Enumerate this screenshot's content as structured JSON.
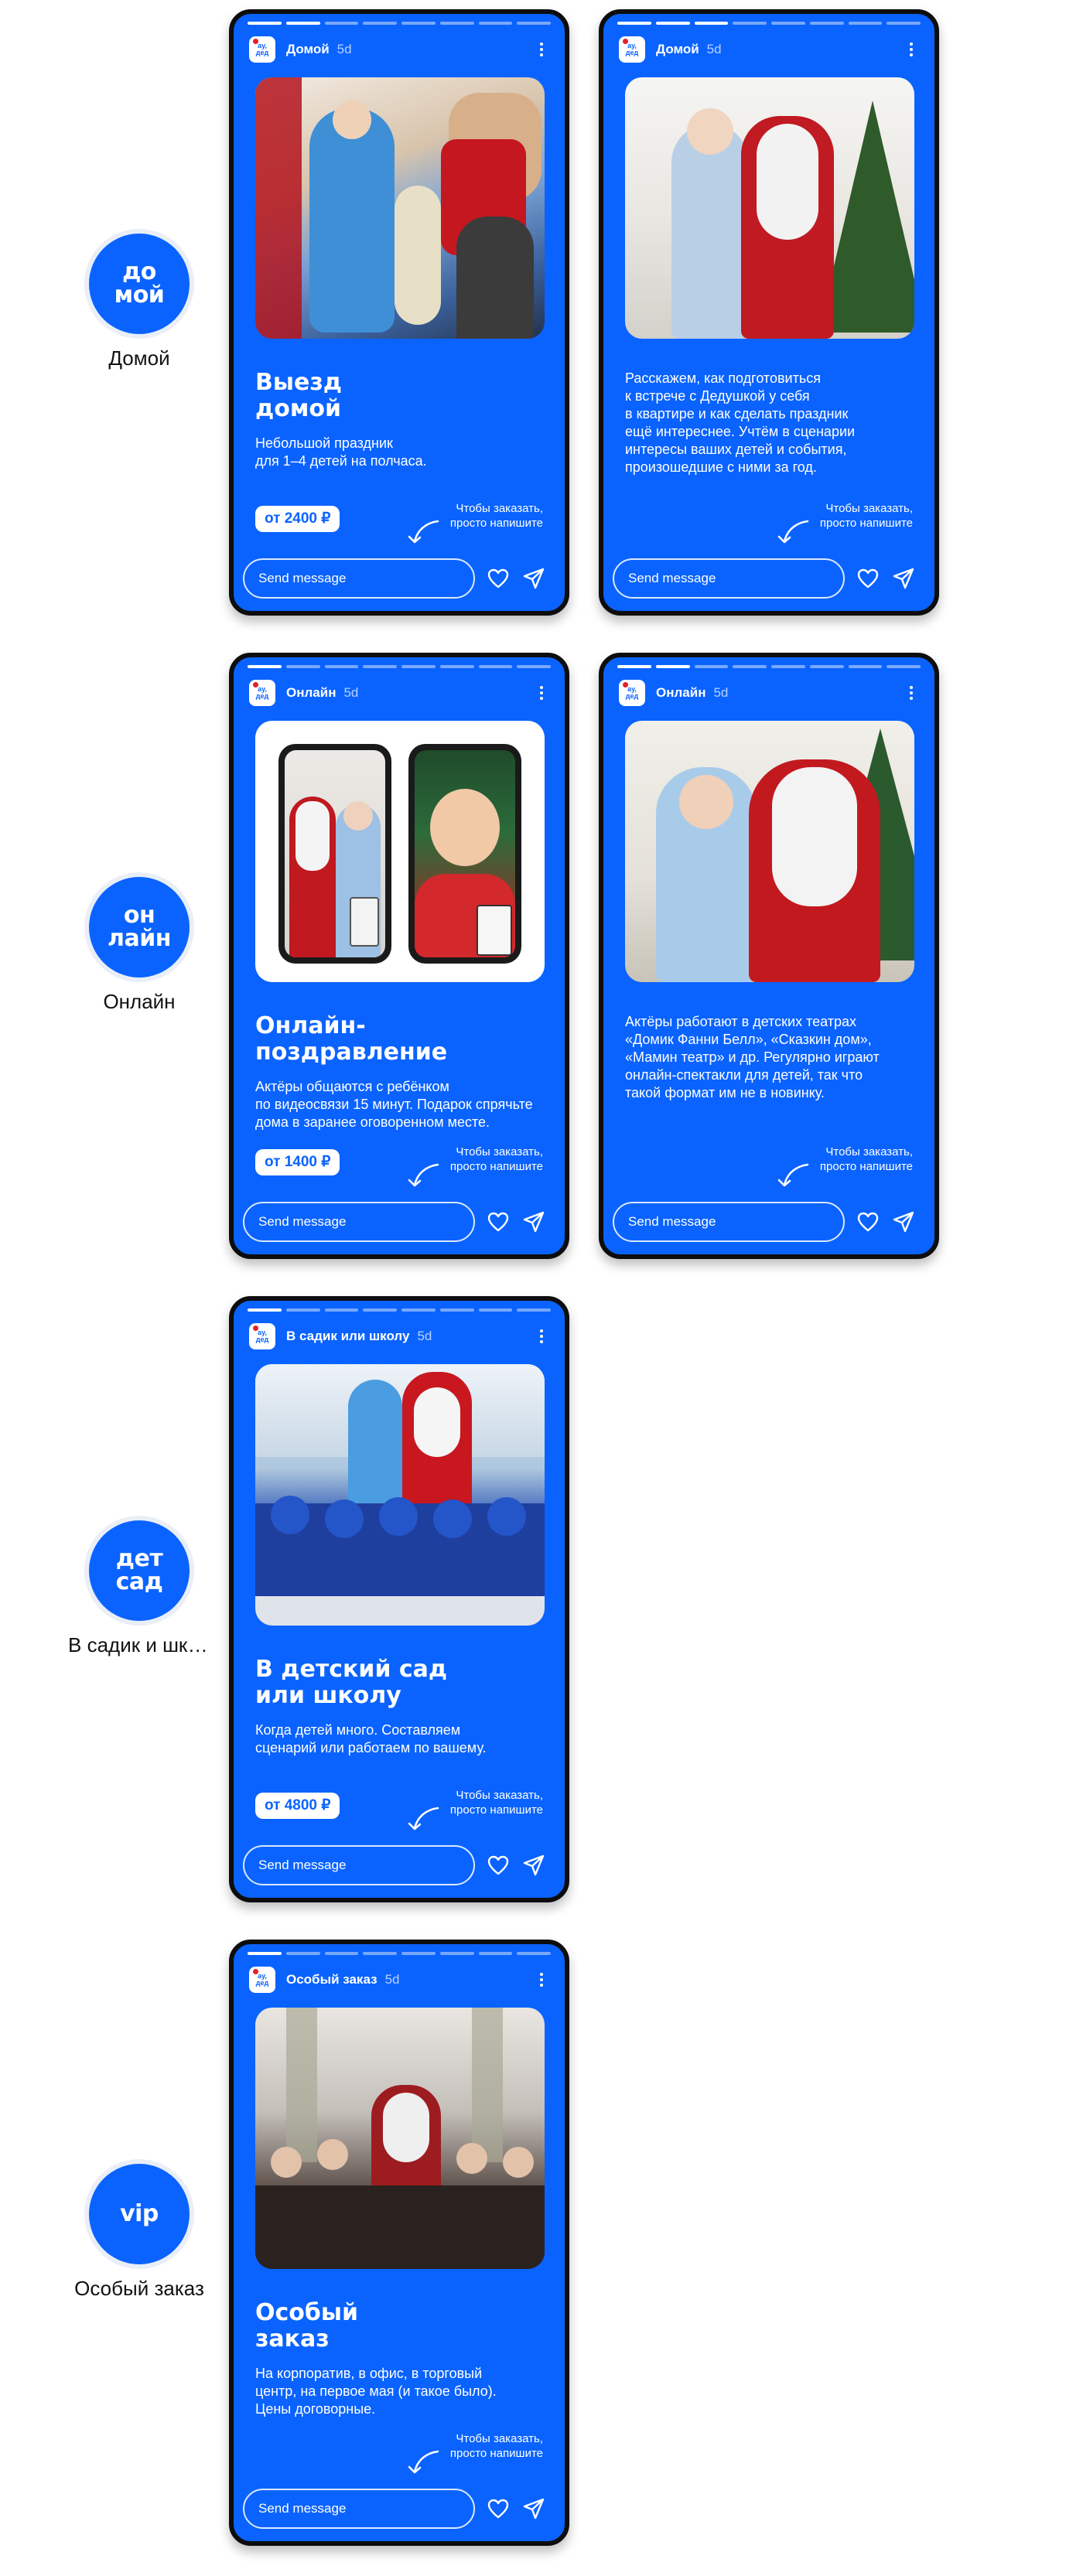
{
  "rows": [
    {
      "highlight": {
        "line1": "до",
        "line2": "мой",
        "label": "Домой"
      },
      "stories": [
        {
          "name": "Домой",
          "time": "5d",
          "title_l1": "Выезд",
          "title_l2": "домой",
          "desc": [
            "Небольшой праздник",
            "для 1–4 детей на полчаса."
          ],
          "price": "от 2400 ₽",
          "hint": [
            "Чтобы заказать,",
            "просто напишите"
          ],
          "input_placeholder": "Send message"
        },
        {
          "name": "Домой",
          "time": "5d",
          "desc": [
            "Расскажем, как подготовиться",
            "к встрече с Дедушкой у себя",
            "в квартире и как сделать праздник",
            "ещё интереснее. Учтём в сценарии",
            "интересы ваших детей и события,",
            "произошедшие с ними за год."
          ],
          "hint": [
            "Чтобы заказать,",
            "просто напишите"
          ],
          "input_placeholder": "Send message"
        }
      ]
    },
    {
      "highlight": {
        "line1": "он",
        "line2": "лайн",
        "label": "Онлайн"
      },
      "stories": [
        {
          "name": "Онлайн",
          "time": "5d",
          "title_l1": "Онлайн-",
          "title_l2": "поздравление",
          "desc": [
            "Актёры общаются с ребёнком",
            "по видеосвязи 15 минут. Подарок спрячьте",
            "дома в заранее оговоренном месте."
          ],
          "price": "от 1400 ₽",
          "hint": [
            "Чтобы заказать,",
            "просто напишите"
          ],
          "input_placeholder": "Send message"
        },
        {
          "name": "Онлайн",
          "time": "5d",
          "desc": [
            "Актёры работают в детских театрах",
            "«Домик Фанни Белл», «Сказкин дом»,",
            "«Мамин театр» и др. Регулярно играют",
            "онлайн-спектакли для детей, так что",
            "такой формат им не в новинку."
          ],
          "hint": [
            "Чтобы заказать,",
            "просто напишите"
          ],
          "input_placeholder": "Send message"
        }
      ]
    },
    {
      "highlight": {
        "line1": "дет",
        "line2": "сад",
        "label": "В садик и школу"
      },
      "stories": [
        {
          "name": "В садик или школу",
          "time": "5d",
          "title_l1": "В детский сад",
          "title_l2": "или школу",
          "desc": [
            "Когда детей много. Составляем",
            "сценарий или работаем по вашему."
          ],
          "price": "от 4800 ₽",
          "hint": [
            "Чтобы заказать,",
            "просто напишите"
          ],
          "input_placeholder": "Send message"
        }
      ]
    },
    {
      "highlight": {
        "line1": "vip",
        "line2": "",
        "label": "Особый заказ"
      },
      "stories": [
        {
          "name": "Особый заказ",
          "time": "5d",
          "title_l1": "Особый",
          "title_l2": "заказ",
          "desc": [
            "На корпоратив, в офис, в торговый",
            "центр, на первое мая (и такое было).",
            "Цены договорные."
          ],
          "price": "",
          "hint": [
            "Чтобы заказать,",
            "просто напишите"
          ],
          "input_placeholder": "Send message"
        }
      ]
    }
  ],
  "logo": {
    "line1": "ay,",
    "line2": "дед"
  },
  "colors": {
    "story_bg": "#0a63ff",
    "frame": "#0d0d0d",
    "price_text": "#0a63ff"
  },
  "icons": [
    "heart-icon",
    "send-icon",
    "more-options-icon",
    "curved-arrow-icon"
  ]
}
